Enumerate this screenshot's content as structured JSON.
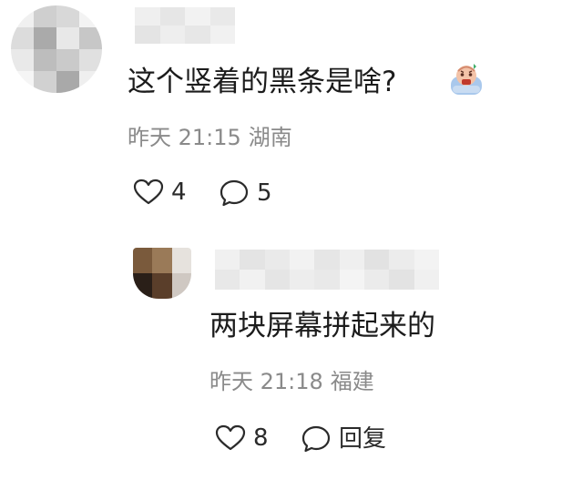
{
  "colors": {
    "text": "#1c1c1c",
    "meta": "#8a8a8a",
    "icon": "#2a2a2a",
    "background": "#ffffff"
  },
  "comment": {
    "text": "这个竖着的黑条是啥?",
    "time": "昨天 21:15",
    "location": "湖南",
    "like_count": "4",
    "comment_count": "5",
    "emoji_icon": "shocked-face-emoji"
  },
  "reply": {
    "text": "两块屏幕拼起来的",
    "time": "昨天 21:18",
    "location": "福建",
    "like_count": "8",
    "reply_label": "回复"
  }
}
